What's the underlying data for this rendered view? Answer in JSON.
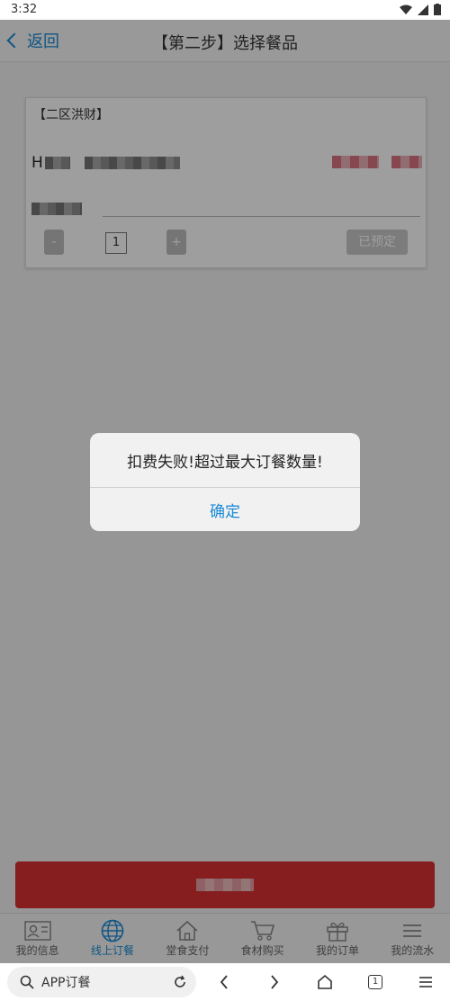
{
  "status_bar": {
    "time": "3:32"
  },
  "header": {
    "back_label": "返回",
    "title": "【第二步】选择餐品"
  },
  "order_item": {
    "restaurant": "【二区洪财】",
    "dish_prefix": "H",
    "quantity": "1",
    "minus_label": "-",
    "plus_label": "+",
    "reserved_label": "已预定"
  },
  "bottom_nav": {
    "tabs": [
      {
        "label": "我的信息",
        "icon": "profile-card-icon",
        "active": false
      },
      {
        "label": "线上订餐",
        "icon": "globe-icon",
        "active": true
      },
      {
        "label": "堂食支付",
        "icon": "home-icon",
        "active": false
      },
      {
        "label": "食材购买",
        "icon": "cart-icon",
        "active": false
      },
      {
        "label": "我的订单",
        "icon": "gift-icon",
        "active": false
      },
      {
        "label": "我的流水",
        "icon": "menu-lines-icon",
        "active": false
      }
    ]
  },
  "browser": {
    "url_text": "APP订餐",
    "tab_count": "1"
  },
  "dialog": {
    "message": "扣费失败!超过最大订餐数量!",
    "ok_label": "确定"
  },
  "colors": {
    "accent": "#1a8ad6",
    "primary_button": "#d83033"
  }
}
